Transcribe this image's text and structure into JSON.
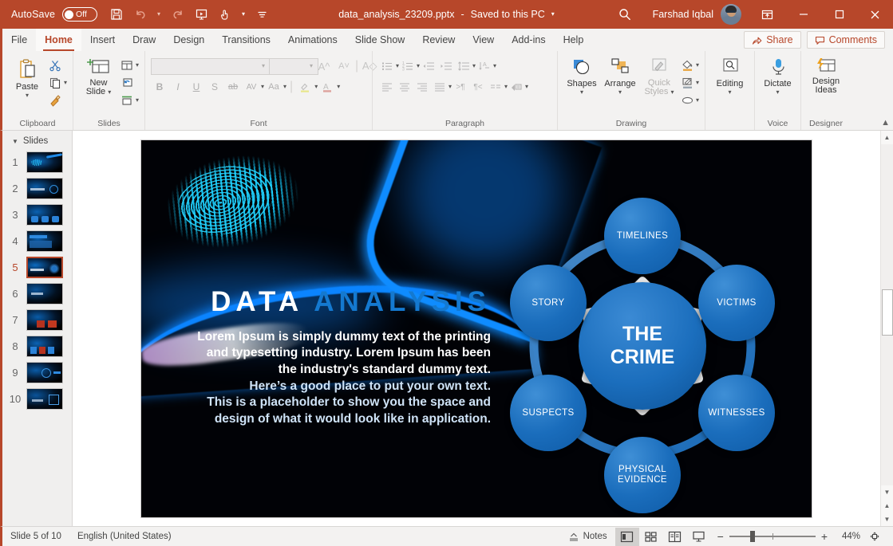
{
  "titlebar": {
    "autosave_label": "AutoSave",
    "autosave_state": "Off",
    "document_title": "data_analysis_23209.pptx",
    "save_state": "Saved to this PC",
    "separator": "-",
    "user_name": "Farshad Iqbal",
    "quick_access": [
      {
        "name": "save-icon",
        "tooltip": "Save"
      },
      {
        "name": "undo-icon",
        "tooltip": "Undo"
      },
      {
        "name": "redo-icon",
        "tooltip": "Redo"
      },
      {
        "name": "start-presentation-icon",
        "tooltip": "Start From Beginning"
      },
      {
        "name": "touch-mode-icon",
        "tooltip": "Touch/Mouse Mode"
      },
      {
        "name": "customize-qat-icon",
        "tooltip": "Customize Quick Access Toolbar"
      }
    ],
    "window_buttons": [
      "ribbon-display-options",
      "minimize",
      "maximize",
      "close"
    ]
  },
  "ribbon": {
    "tabs": [
      {
        "label": "File",
        "active": false
      },
      {
        "label": "Home",
        "active": true
      },
      {
        "label": "Insert",
        "active": false
      },
      {
        "label": "Draw",
        "active": false
      },
      {
        "label": "Design",
        "active": false
      },
      {
        "label": "Transitions",
        "active": false
      },
      {
        "label": "Animations",
        "active": false
      },
      {
        "label": "Slide Show",
        "active": false
      },
      {
        "label": "Review",
        "active": false
      },
      {
        "label": "View",
        "active": false
      },
      {
        "label": "Add-ins",
        "active": false
      },
      {
        "label": "Help",
        "active": false
      }
    ],
    "share_label": "Share",
    "comments_label": "Comments",
    "groups": {
      "clipboard": {
        "label": "Clipboard",
        "paste_label": "Paste",
        "items": [
          "cut-icon",
          "copy-icon",
          "format-painter-icon"
        ]
      },
      "slides": {
        "label": "Slides",
        "new_slide_label": "New\nSlide",
        "new_slide_line1": "New",
        "new_slide_line2": "Slide",
        "items": [
          "layout-icon",
          "reset-icon",
          "section-icon"
        ]
      },
      "font": {
        "label": "Font",
        "font_name_value": "",
        "font_size_value": "",
        "font_name_placeholder": "",
        "font_size_placeholder": "",
        "buttons": [
          "bold",
          "italic",
          "underline",
          "text-shadow",
          "strikethrough",
          "character-spacing",
          "change-case",
          "text-highlight-color",
          "font-color",
          "increase-font-size",
          "decrease-font-size",
          "clear-formatting"
        ],
        "disabled": true
      },
      "paragraph": {
        "label": "Paragraph",
        "buttons": [
          "bullets",
          "numbering",
          "decrease-indent",
          "increase-indent",
          "line-spacing",
          "align-left",
          "center",
          "align-right",
          "justify",
          "columns",
          "text-direction",
          "align-text",
          "convert-to-smartart"
        ],
        "disabled": true
      },
      "drawing": {
        "label": "Drawing",
        "shapes_label": "Shapes",
        "arrange_label": "Arrange",
        "quick_styles_label": "Quick\nStyles",
        "quick_styles_line1": "Quick",
        "quick_styles_line2": "Styles",
        "items": [
          "shape-fill-icon",
          "shape-outline-icon",
          "shape-effects-icon"
        ]
      },
      "editing": {
        "label": "",
        "button_label": "Editing"
      },
      "voice": {
        "label": "Voice",
        "button_label": "Dictate"
      },
      "designer": {
        "label": "Designer",
        "button_label_line1": "Design",
        "button_label_line2": "Ideas"
      }
    }
  },
  "slide_panel": {
    "header": "Slides",
    "slides": [
      {
        "number": "1",
        "selected": false
      },
      {
        "number": "2",
        "selected": false
      },
      {
        "number": "3",
        "selected": false
      },
      {
        "number": "4",
        "selected": false
      },
      {
        "number": "5",
        "selected": true
      },
      {
        "number": "6",
        "selected": false
      },
      {
        "number": "7",
        "selected": false
      },
      {
        "number": "8",
        "selected": false
      },
      {
        "number": "9",
        "selected": false
      },
      {
        "number": "10",
        "selected": false
      }
    ]
  },
  "slide": {
    "title_part1": "DATA",
    "title_part2": "ANALYSIS",
    "body_lines": [
      {
        "text": "Lorem Ipsum is simply dummy text of the printing",
        "color": "white"
      },
      {
        "text": "and typesetting industry. Lorem Ipsum has been",
        "color": "white"
      },
      {
        "text": "the industry's standard dummy text.",
        "color": "white"
      },
      {
        "text": "Here’s a good place to put your own text.",
        "color": "blue"
      },
      {
        "text": "This is a placeholder to show you the space and",
        "color": "blue"
      },
      {
        "text": "design of what it would look like in application.",
        "color": "blue"
      }
    ],
    "diagram": {
      "center_line1": "THE",
      "center_line2": "CRIME",
      "nodes": [
        {
          "label": "TIMELINES",
          "position": "top"
        },
        {
          "label": "VICTIMS",
          "position": "top-right"
        },
        {
          "label": "WITNESSES",
          "position": "bottom-right"
        },
        {
          "label": "PHYSICAL EVIDENCE",
          "position": "bottom",
          "line1": "PHYSICAL",
          "line2": "EVIDENCE"
        },
        {
          "label": "SUSPECTS",
          "position": "bottom-left"
        },
        {
          "label": "STORY",
          "position": "top-left"
        }
      ]
    },
    "colors": {
      "title_accent": "#1479d0",
      "node_fill": "#1a6dbc",
      "arrow_fill": "#0b3f78",
      "background": "#000000"
    }
  },
  "statusbar": {
    "slide_indicator": "Slide 5 of 10",
    "language": "English (United States)",
    "notes_label": "Notes",
    "views": [
      {
        "name": "normal-view",
        "active": true
      },
      {
        "name": "slide-sorter-view",
        "active": false
      },
      {
        "name": "reading-view",
        "active": false
      },
      {
        "name": "slide-show-view",
        "active": false
      }
    ],
    "zoom_out_label": "−",
    "zoom_in_label": "+",
    "zoom_level": "44%",
    "fit_label": "fit-to-window-icon"
  }
}
